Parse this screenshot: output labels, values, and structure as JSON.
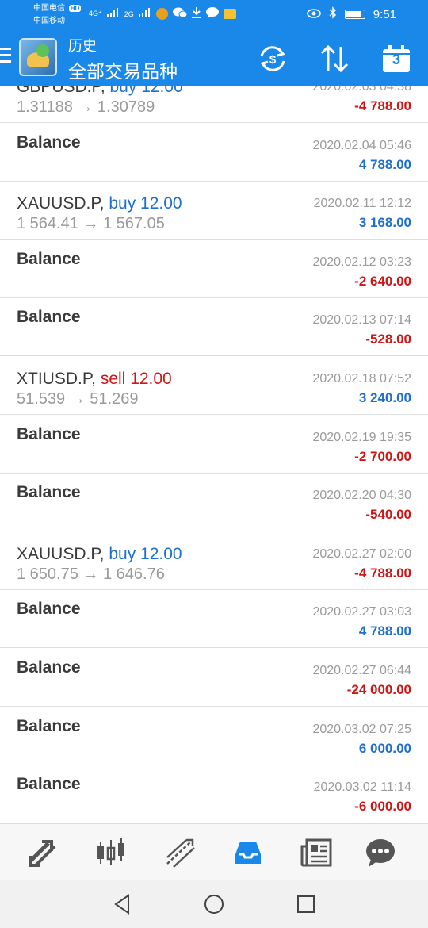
{
  "status_bar": {
    "carrier1": "中国电信",
    "carrier1_badge": "HD",
    "net1": "4G⁺",
    "net2": "2G",
    "carrier2": "中国移动",
    "time": "9:51"
  },
  "app_bar": {
    "title": "历史",
    "subtitle": "全部交易品种",
    "calendar_day": "3"
  },
  "history": [
    {
      "symbol": "GBPUSD.P,",
      "direction": "buy",
      "volume": "12.00",
      "prices": "1.31188 → 1.30789",
      "date": "2020.02.03 04:38",
      "amount": "-4 788.00",
      "amount_color": "#d01515"
    },
    {
      "symbol": "Balance",
      "date": "2020.02.04 05:46",
      "amount": "4 788.00",
      "amount_color": "#1f6fd0"
    },
    {
      "symbol": "XAUUSD.P,",
      "direction": "buy",
      "volume": "12.00",
      "prices": "1 564.41 → 1 567.05",
      "date": "2020.02.11 12:12",
      "amount": "3 168.00",
      "amount_color": "#1f6fd0"
    },
    {
      "symbol": "Balance",
      "date": "2020.02.12 03:23",
      "amount": "-2 640.00",
      "amount_color": "#d01515"
    },
    {
      "symbol": "Balance",
      "date": "2020.02.13 07:14",
      "amount": "-528.00",
      "amount_color": "#d01515"
    },
    {
      "symbol": "XTIUSD.P,",
      "direction": "sell",
      "volume": "12.00",
      "prices": "51.539 → 51.269",
      "date": "2020.02.18 07:52",
      "amount": "3 240.00",
      "amount_color": "#1f6fd0"
    },
    {
      "symbol": "Balance",
      "date": "2020.02.19 19:35",
      "amount": "-2 700.00",
      "amount_color": "#d01515"
    },
    {
      "symbol": "Balance",
      "date": "2020.02.20 04:30",
      "amount": "-540.00",
      "amount_color": "#d01515"
    },
    {
      "symbol": "XAUUSD.P,",
      "direction": "buy",
      "volume": "12.00",
      "prices": "1 650.75 → 1 646.76",
      "date": "2020.02.27 02:00",
      "amount": "-4 788.00",
      "amount_color": "#d01515"
    },
    {
      "symbol": "Balance",
      "date": "2020.02.27 03:03",
      "amount": "4 788.00",
      "amount_color": "#1f6fd0"
    },
    {
      "symbol": "Balance",
      "date": "2020.02.27 06:44",
      "amount": "-24 000.00",
      "amount_color": "#d01515"
    },
    {
      "symbol": "Balance",
      "date": "2020.03.02 07:25",
      "amount": "6 000.00",
      "amount_color": "#1f6fd0"
    },
    {
      "symbol": "Balance",
      "date": "2020.03.02 11:14",
      "amount": "-6 000.00",
      "amount_color": "#d01515"
    }
  ],
  "bottom_nav": {
    "items": [
      {
        "icon": "quotes-arrows-icon",
        "active": false
      },
      {
        "icon": "candlestick-chart-icon",
        "active": false
      },
      {
        "icon": "trade-lines-icon",
        "active": false
      },
      {
        "icon": "history-inbox-icon",
        "active": true
      },
      {
        "icon": "news-icon",
        "active": false
      },
      {
        "icon": "chat-bubble-icon",
        "active": false
      }
    ],
    "active_color": "#1a88e8",
    "inactive_color": "#555555"
  },
  "system_nav": {
    "buttons": [
      "back-icon",
      "home-icon",
      "recents-icon"
    ]
  }
}
